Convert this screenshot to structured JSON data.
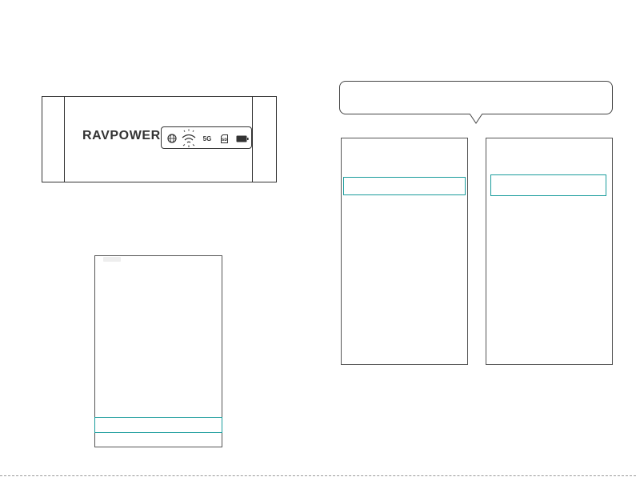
{
  "device": {
    "brand": "RAVPOWER",
    "indicators": [
      {
        "icon": "globe-icon"
      },
      {
        "icon": "wifi-icon"
      },
      {
        "label": "5G"
      },
      {
        "icon": "sd-card-icon"
      },
      {
        "icon": "battery-icon"
      }
    ]
  },
  "colors": {
    "highlight": "#1a9c9c",
    "line": "#333333"
  }
}
